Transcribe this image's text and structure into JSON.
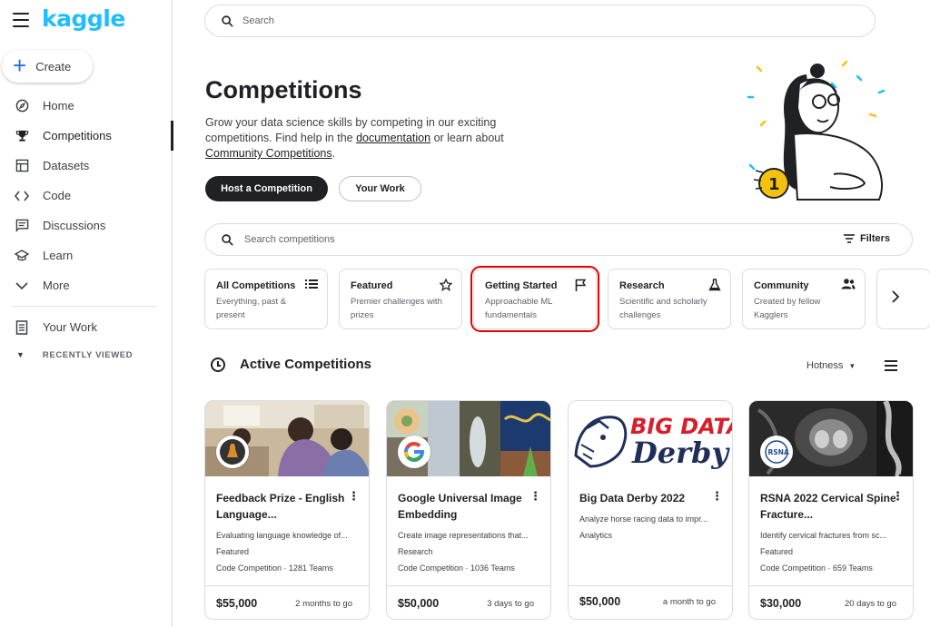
{
  "app": {
    "logo": "kaggle"
  },
  "sidebar": {
    "create_label": "Create",
    "items": [
      {
        "label": "Home",
        "icon": "compass-icon"
      },
      {
        "label": "Competitions",
        "icon": "trophy-icon",
        "active": true
      },
      {
        "label": "Datasets",
        "icon": "table-icon"
      },
      {
        "label": "Code",
        "icon": "code-icon"
      },
      {
        "label": "Discussions",
        "icon": "chat-icon"
      },
      {
        "label": "Learn",
        "icon": "graduation-cap-icon"
      },
      {
        "label": "More",
        "icon": "chevron-down-icon"
      }
    ],
    "your_work": "Your Work",
    "recently_viewed": "RECENTLY VIEWED"
  },
  "search": {
    "placeholder": "Search"
  },
  "hero": {
    "title": "Competitions",
    "desc_part1": "Grow your data science skills by competing in our exciting competitions. Find help in the ",
    "desc_link1": "documentation",
    "desc_part2": " or learn about ",
    "desc_link2": "Community Competitions",
    "desc_part3": ".",
    "host_button": "Host a Competition",
    "your_work_button": "Your Work"
  },
  "comp_search": {
    "placeholder": "Search competitions",
    "filters_label": "Filters"
  },
  "categories": [
    {
      "title": "All Competitions",
      "desc": "Everything, past & present",
      "icon": "list-icon"
    },
    {
      "title": "Featured",
      "desc": "Premier challenges with prizes",
      "icon": "star-icon"
    },
    {
      "title": "Getting Started",
      "desc": "Approachable ML fundamentals",
      "icon": "flag-icon",
      "selected": true
    },
    {
      "title": "Research",
      "desc": "Scientific and scholarly challenges",
      "icon": "flask-icon"
    },
    {
      "title": "Community",
      "desc": "Created by fellow Kagglers",
      "icon": "people-icon"
    }
  ],
  "active": {
    "title": "Active Competitions",
    "sort": "Hotness"
  },
  "cards": [
    {
      "title": "Feedback Prize - English Language...",
      "desc": "Evaluating language knowledge of...",
      "category": "Featured",
      "meta": "Code Competition · 1281 Teams",
      "prize": "$55,000",
      "due": "2 months to go"
    },
    {
      "title": "Google Universal Image Embedding",
      "desc": "Create image representations that...",
      "category": "Research",
      "meta": "Code Competition · 1036 Teams",
      "prize": "$50,000",
      "due": "3 days to go"
    },
    {
      "title": "Big Data Derby 2022",
      "desc": "Analyze horse racing data to impr...",
      "category": "Analytics",
      "meta": "",
      "prize": "$50,000",
      "due": "a month to go",
      "banner_line1": "BIG DATA",
      "banner_line2": "Derby"
    },
    {
      "title": "RSNA 2022 Cervical Spine Fracture...",
      "desc": "Identify cervical fractures from sc...",
      "category": "Featured",
      "meta": "Code Competition · 659 Teams",
      "prize": "$30,000",
      "due": "20 days to go",
      "badge_text": "RSNA"
    }
  ],
  "colors": {
    "accent": "#20beff",
    "selected_outline": "#e60000",
    "dark_button": "#202124"
  }
}
